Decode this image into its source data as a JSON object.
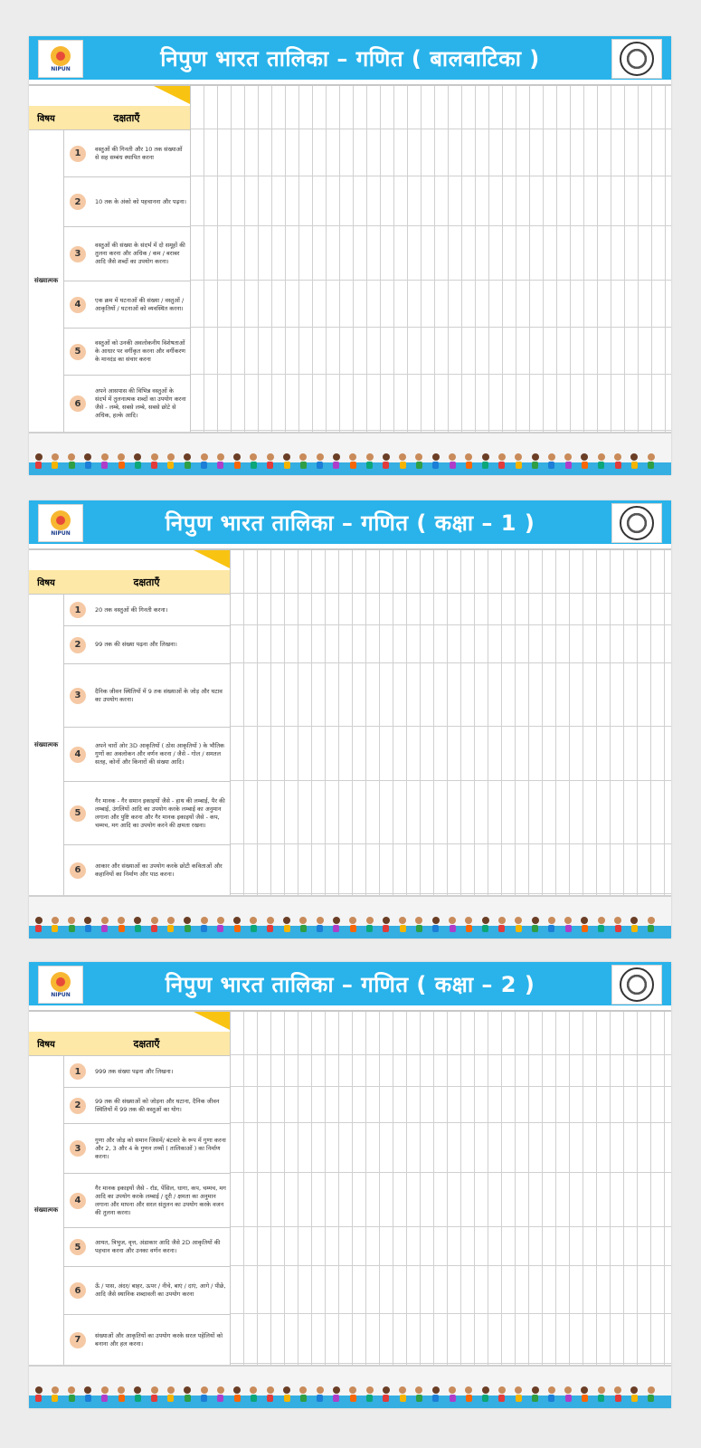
{
  "sheets": [
    {
      "title": "निपुण भारत तालिका – गणित ( बालवाटिका )",
      "subject_header": "विषय",
      "competency_header": "दक्षताएँ",
      "subject": "संख्यात्मक",
      "logo_left": "NIPUN",
      "rows": [
        {
          "n": "1",
          "text": "वस्तुओं की गिनती और 10 तक संख्याओं से सह सम्बंध स्थापित करना"
        },
        {
          "n": "2",
          "text": "10 तक के अंको को पहचानना और पढ़ना।"
        },
        {
          "n": "3",
          "text": "वस्तुओं की संख्या के संदर्भ में दो समूहों की तुलना करना और अधिक / कम / बराबर आदि जैसे शब्दों का उपयोग करना।"
        },
        {
          "n": "4",
          "text": "एक क्रम में घटनाओं की संख्या / वस्तुओं / आकृतियों / घटनाओं को व्यवस्थित करना।"
        },
        {
          "n": "5",
          "text": "वस्तुओं को उनकी अवलोकनीय विशेषताओं के आधार पर वर्गीकृत करना और वर्गीकरण के मानदंड का संचार करना"
        },
        {
          "n": "6",
          "text": "अपने आसपास की विभिन्न वस्तुओं के संदर्भ में तुलनात्मक शब्दों का उपयोग करना जैसे - लम्बे, सबसे लम्बे, सबसे छोटे से अधिक, हल्के आदि।"
        }
      ]
    },
    {
      "title": "निपुण भारत तालिका – गणित ( कक्षा – 1 )",
      "subject_header": "विषय",
      "competency_header": "दक्षताएँ",
      "subject": "संख्यात्मक",
      "logo_left": "NIPUN",
      "rows": [
        {
          "n": "1",
          "text": "20 तक वस्तुओं की गिनती करना।"
        },
        {
          "n": "2",
          "text": "99 तक की संख्या पढ़ना और लिखना।"
        },
        {
          "n": "3",
          "text": "दैनिक जीवन स्थितियों में 9 तक संख्याओं के जोड़ और घटाव का उपयोग करना।"
        },
        {
          "n": "4",
          "text": "अपने चारों ओर 3D आकृतियों ( ठोस आकृतियों ) के भौतिक गुणों का अवलोकन और वर्णन करना / जैसे - गोल / समतल सतह, कोनों और किनारों की संख्या आदि।"
        },
        {
          "n": "5",
          "text": "गैर मानक - गैर समान इकाइयों जैसे - हाथ की लम्बाई, पैर की लम्बाई, उंगलियों आदि का उपयोग करके लम्बाई का अनुमान लगाना और पुष्टि करना और गैर मानक इकाइयों जैसे - कप, चम्मच, मग आदि का उपयोग करने की क्षमता रखना।"
        },
        {
          "n": "6",
          "text": "आकार और संख्याओं का उपयोग करके छोटी कविताओं और कहानियों का निर्माण और पाठ करना।"
        }
      ]
    },
    {
      "title": "निपुण भारत तालिका – गणित ( कक्षा – 2 )",
      "subject_header": "विषय",
      "competency_header": "दक्षताएँ",
      "subject": "संख्यात्मक",
      "logo_left": "NIPUN",
      "rows": [
        {
          "n": "1",
          "text": "999 तक संख्या पढ़ना और लिखना।"
        },
        {
          "n": "2",
          "text": "99 तक की संख्याओं को जोड़ना और घटाना, दैनिक जीवन स्थितियों में 99 तक की वस्तुओं का योग।"
        },
        {
          "n": "3",
          "text": "गुणा और जोड़ को समान जिसमें/ बंटवारे के रूप में गुणा करना और 2, 3 और 4 के गुणन तथ्यों ( तालिकाओं ) का निर्माण करना।"
        },
        {
          "n": "4",
          "text": "गैर मानक इकाइयों जैसे - रॉड, पेंसिल, धागा, कप, चम्मच, मग आदि का उपयोग करके लम्बाई / दूरी / क्षमता का अनुमान लगाना और मापना और सरल संतुलन का उपयोग करके वजन की तुलना करना।"
        },
        {
          "n": "5",
          "text": "आयत, त्रिभुज, वृत्त, अंडाकार आदि जैसे 2D आकृतियों की पहचान करना और उनका वर्णन करना।"
        },
        {
          "n": "6",
          "text": "ऊँ / पास, अंदर/ बाहर, ऊपर / नीचे, बाएं / दाएं, आगे / पीछे, आदि जैसे स्थानिक शब्दावली का उपयोग करना"
        },
        {
          "n": "7",
          "text": "संख्याओं और आकृतियों का उपयोग करके सरल पहेलियों को बनाना और हल करना।"
        }
      ]
    }
  ],
  "colors": {
    "header_blue": "#29b3ea",
    "accent_yellow": "#f9c312",
    "number_circle": "#f5c9a5"
  },
  "icons": {
    "left_logo": "nipun-logo-icon",
    "right_logo": "state-seal-icon"
  }
}
